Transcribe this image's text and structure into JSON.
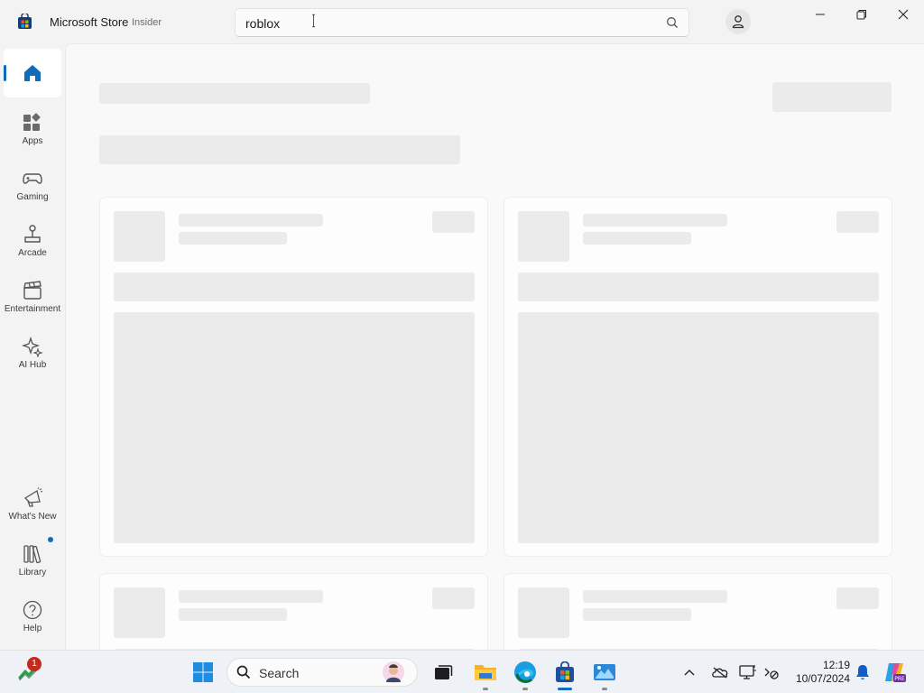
{
  "window": {
    "title": "Microsoft Store",
    "badge": "Insider",
    "minimize_icon": "minimize-icon",
    "restore_icon": "restore-icon",
    "close_icon": "close-icon"
  },
  "search": {
    "value": "roblox",
    "icon": "search-icon"
  },
  "sidebar": {
    "items": [
      {
        "label": "",
        "icon": "home-icon",
        "selected": true
      },
      {
        "label": "Apps",
        "icon": "apps-icon"
      },
      {
        "label": "Gaming",
        "icon": "gamepad-icon"
      },
      {
        "label": "Arcade",
        "icon": "joystick-icon"
      },
      {
        "label": "Entertainment",
        "icon": "clapperboard-icon"
      },
      {
        "label": "AI Hub",
        "icon": "sparkle-icon"
      }
    ],
    "bottom_items": [
      {
        "label": "What's New",
        "icon": "megaphone-icon"
      },
      {
        "label": "Library",
        "icon": "library-icon",
        "has_update_dot": true
      },
      {
        "label": "Help",
        "icon": "help-icon"
      }
    ]
  },
  "content": {
    "state": "loading-skeleton"
  },
  "taskbar": {
    "widgets_badge": "1",
    "search_label": "Search",
    "apps": [
      "start-icon",
      "task-view-icon",
      "file-explorer-icon",
      "edge-icon",
      "store-icon",
      "photos-icon"
    ],
    "tray_icons": [
      "chevron-up-icon",
      "onedrive-icon",
      "display-icon",
      "accessibility-icon"
    ],
    "time": "12:19",
    "date": "10/07/2024",
    "colors": {
      "accent": "#0f6cbd",
      "badge": "#c42b1c"
    }
  }
}
